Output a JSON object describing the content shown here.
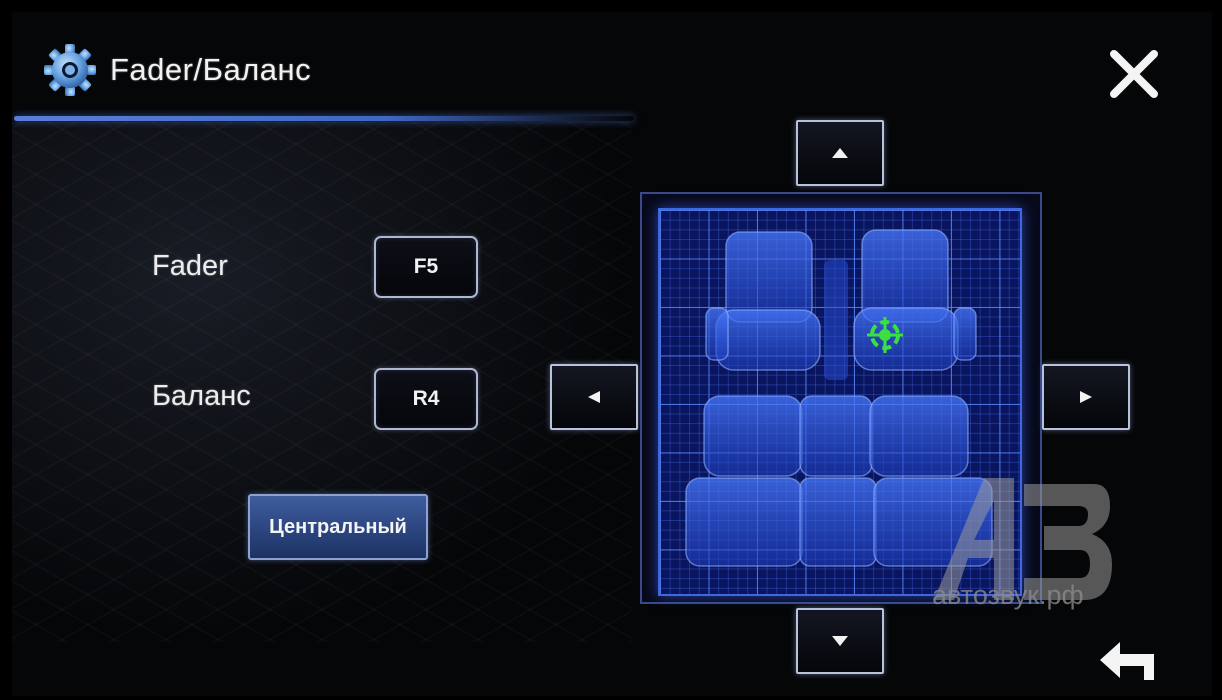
{
  "header": {
    "title": "Fader/Баланс",
    "icon": "gear-icon"
  },
  "fader": {
    "label": "Fader",
    "value": "F5"
  },
  "balance": {
    "label": "Баланс",
    "value": "R4"
  },
  "center_button": {
    "label": "Центральный"
  },
  "controls": {
    "up_icon": "arrow-up-icon",
    "down_icon": "arrow-down-icon",
    "left_icon": "arrow-left-icon",
    "right_icon": "arrow-right-icon",
    "close_icon": "close-icon",
    "back_icon": "back-arrow-icon"
  },
  "grid": {
    "marker_icon": "crosshair-icon",
    "marker_color": "#39e03f",
    "grid_color": "#5a8cff"
  },
  "watermark": {
    "logo": "АЗ",
    "text": "автозвук.рф"
  },
  "colors": {
    "accent": "#3f67c4",
    "grid_bg": "#0a1560"
  }
}
